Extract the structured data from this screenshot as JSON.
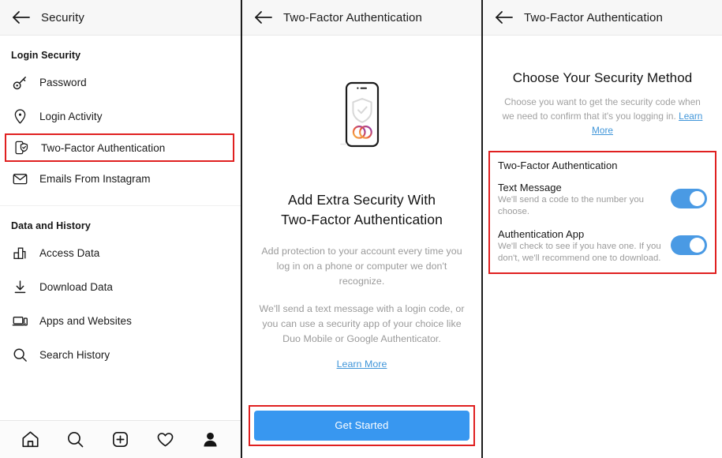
{
  "panel1": {
    "header": {
      "back_icon": "back-arrow-icon",
      "title": "Security"
    },
    "sections": [
      {
        "title": "Login Security",
        "items": [
          {
            "icon": "key-icon",
            "label": "Password",
            "highlighted": false
          },
          {
            "icon": "location-pin-icon",
            "label": "Login Activity",
            "highlighted": false
          },
          {
            "icon": "phone-shield-icon",
            "label": "Two-Factor Authentication",
            "highlighted": true
          },
          {
            "icon": "envelope-icon",
            "label": "Emails From Instagram",
            "highlighted": false
          }
        ]
      },
      {
        "title": "Data and History",
        "items": [
          {
            "icon": "bar-chart-icon",
            "label": "Access Data",
            "highlighted": false
          },
          {
            "icon": "download-arrow-icon",
            "label": "Download Data",
            "highlighted": false
          },
          {
            "icon": "apps-websites-icon",
            "label": "Apps and Websites",
            "highlighted": false
          },
          {
            "icon": "magnifier-icon",
            "label": "Search History",
            "highlighted": false
          }
        ]
      }
    ],
    "tabbar": [
      {
        "icon": "home-icon",
        "label": "Home"
      },
      {
        "icon": "search-icon",
        "label": "Search"
      },
      {
        "icon": "add-post-icon",
        "label": "Create"
      },
      {
        "icon": "heart-icon",
        "label": "Activity"
      },
      {
        "icon": "profile-icon",
        "label": "Profile"
      }
    ]
  },
  "panel2": {
    "header": {
      "back_icon": "back-arrow-icon",
      "title": "Two-Factor Authentication"
    },
    "illustration": "phone-with-shield-and-toggle-illustration",
    "heading_line1": "Add Extra Security With",
    "heading_line2": "Two-Factor Authentication",
    "paragraph1": "Add protection to your account every time you log in on a phone or computer we don't recognize.",
    "paragraph2": "We'll send a text message with a login code, or you can use a security app of your choice like Duo Mobile or Google Authenticator.",
    "learn_more": "Learn More",
    "cta_label": "Get Started"
  },
  "panel3": {
    "header": {
      "back_icon": "back-arrow-icon",
      "title": "Two-Factor Authentication"
    },
    "title": "Choose Your Security Method",
    "subtitle": "Choose you want to get the security code when we need to confirm that it's you logging in.",
    "subtitle_link": "Learn More",
    "options_box_title": "Two-Factor Authentication",
    "options": [
      {
        "name": "Text Message",
        "desc": "We'll send a code to the number you choose.",
        "toggle_on": true
      },
      {
        "name": "Authentication App",
        "desc": "We'll check to see if you have one. If you don't, we'll recommend one to download.",
        "toggle_on": true
      }
    ]
  },
  "colors": {
    "highlight_red": "#e02020",
    "accent_blue": "#3897f0",
    "link_blue": "#3f95d9",
    "toggle_on": "#4a9ae4"
  }
}
